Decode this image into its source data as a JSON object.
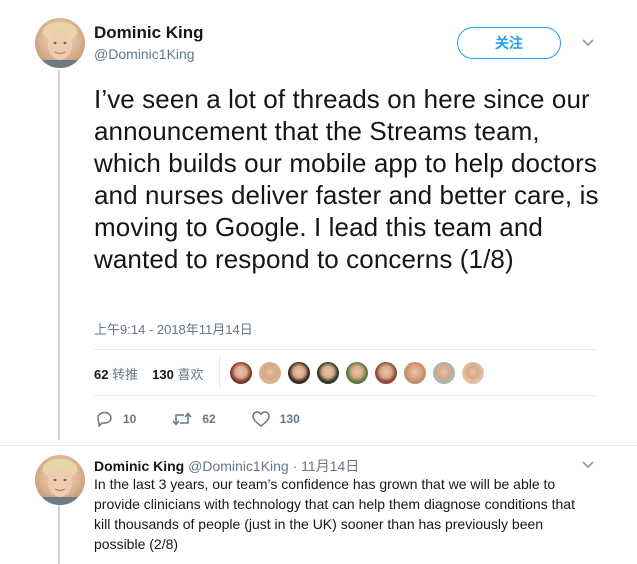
{
  "tweet": {
    "author_name": "Dominic King",
    "author_handle": "@Dominic1King",
    "follow_label": "关注",
    "text": "I’ve seen a lot of threads on here since our announcement that the Streams team, which builds our mobile app to help doctors and nurses deliver faster and better care, is moving to Google. I lead this team and wanted to respond to concerns (1/8)",
    "timestamp": "上午9:14 - 2018年11月14日",
    "retweet_count": "62",
    "retweet_label": "转推",
    "like_count": "130",
    "like_label": "喜欢",
    "reply_action_count": "10",
    "retweet_action_count": "62",
    "like_action_count": "130",
    "liker_face_colors": [
      "#7a3b2e",
      "#d9b38c",
      "#3a2a24",
      "#2f3a2a",
      "#5b7a3e",
      "#8c4a3a",
      "#c48e6e",
      "#a9b7b0",
      "#e3c2a8"
    ]
  },
  "reply": {
    "author_name": "Dominic King",
    "author_handle": "@Dominic1King",
    "date": "· 11月14日",
    "text": "In the last 3 years, our team’s confidence has grown that we will be able to provide clinicians with technology that can help them diagnose conditions that kill thousands of people (just in the UK) sooner than has previously been possible (2/8)"
  },
  "colors": {
    "accent": "#1da1f2",
    "secondary_text": "#657786",
    "divider": "#e6ecf0"
  }
}
